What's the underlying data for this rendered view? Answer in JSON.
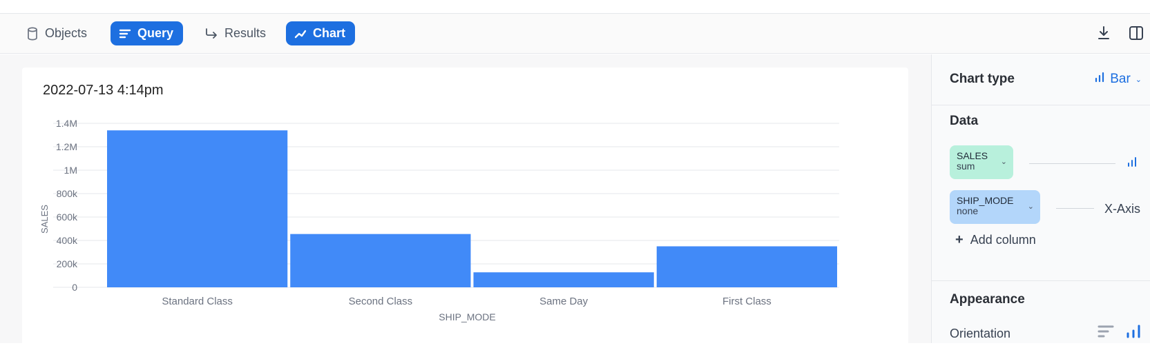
{
  "toolbar": {
    "tabs": [
      {
        "label": "Objects",
        "icon": "database-icon",
        "active": false
      },
      {
        "label": "Query",
        "icon": "query-lines-icon",
        "active": true
      },
      {
        "label": "Results",
        "icon": "arrow-turn-icon",
        "active": false
      },
      {
        "label": "Chart",
        "icon": "line-chart-icon",
        "active": true
      }
    ],
    "right_icons": [
      "download-icon",
      "split-panel-icon"
    ]
  },
  "card": {
    "title": "2022-07-13 4:14pm"
  },
  "chart_data": {
    "type": "bar",
    "categories": [
      "Standard Class",
      "Second Class",
      "Same Day",
      "First Class"
    ],
    "values": [
      1340000,
      455000,
      128000,
      350000
    ],
    "xlabel": "SHIP_MODE",
    "ylabel": "SALES",
    "ylim": [
      0,
      1400000
    ],
    "yticks": [
      0,
      200000,
      400000,
      600000,
      800000,
      1000000,
      1200000,
      1400000
    ],
    "ytick_labels": [
      "0",
      "200k",
      "400k",
      "600k",
      "800k",
      "1M",
      "1.2M",
      "1.4M"
    ],
    "grid": true,
    "bar_color": "#418af8"
  },
  "panel": {
    "chart_type_heading": "Chart type",
    "chart_type_value": "Bar",
    "data_heading": "Data",
    "pills": [
      {
        "title": "SALES",
        "sub": "sum",
        "color": "#b8f0dc"
      },
      {
        "title": "SHIP_MODE",
        "sub": "none",
        "color": "#b3d6fa"
      }
    ],
    "x_axis_label": "X-Axis",
    "add_column": "Add column",
    "appearance_heading": "Appearance",
    "orientation_label": "Orientation"
  },
  "colors": {
    "accent": "#1d6fe0",
    "bar": "#418af8"
  }
}
